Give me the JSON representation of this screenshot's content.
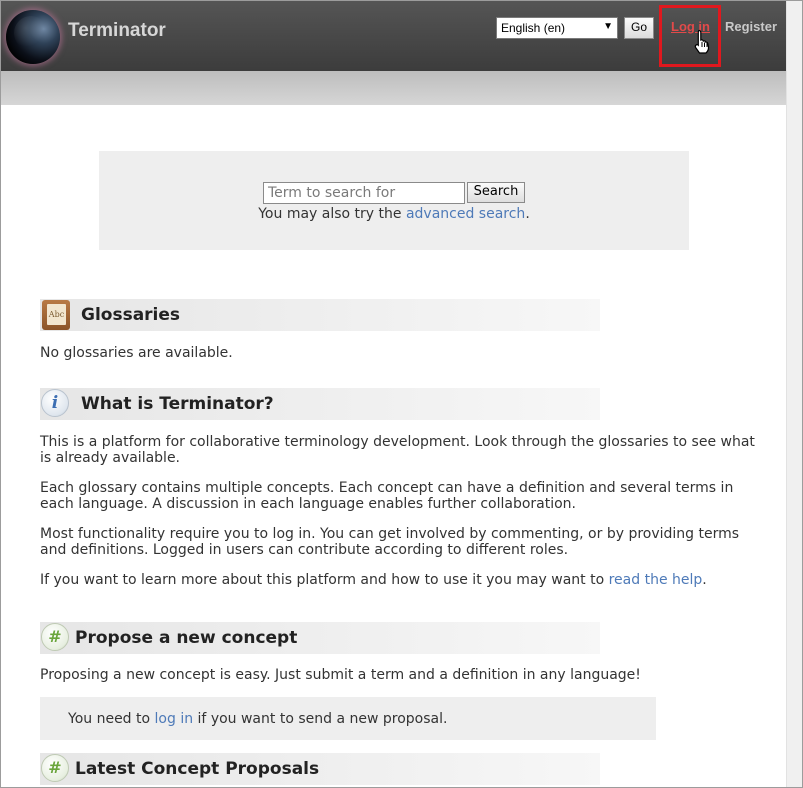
{
  "header": {
    "app_title": "Terminator",
    "language": {
      "selected": "English (en)"
    },
    "go_label": "Go",
    "login_label": "Log in",
    "register_label": "Register"
  },
  "search": {
    "placeholder": "Term to search for",
    "button_label": "Search",
    "hint_prefix": "You may also try the ",
    "hint_link": "advanced search",
    "hint_suffix": "."
  },
  "sections": {
    "glossaries": {
      "title": "Glossaries",
      "icon_text": "Abc",
      "empty_text": "No glossaries are available."
    },
    "about": {
      "title": "What is Terminator?",
      "icon_glyph": "i",
      "p1": "This is a platform for collaborative terminology development. Look through the glossaries to see what is already available.",
      "p2": "Each glossary contains multiple concepts. Each concept can have a definition and several terms in each language. A discussion in each language enables further collaboration.",
      "p3": "Most functionality require you to log in. You can get involved by commenting, or by providing terms and definitions. Logged in users can contribute according to different roles.",
      "p4_prefix": "If you want to learn more about this platform and how to use it you may want to ",
      "p4_link": "read the help",
      "p4_suffix": "."
    },
    "propose": {
      "title": "Propose a new concept",
      "icon_glyph": "#",
      "text": "Proposing a new concept is easy. Just submit a term and a definition in any language!",
      "note_prefix": "You need to ",
      "note_link": "log in",
      "note_suffix": " if you want to send a new proposal."
    },
    "latest": {
      "title": "Latest Concept Proposals",
      "icon_glyph": "#"
    }
  },
  "colors": {
    "header_bg": "#484848",
    "login_highlight": "#e0181e",
    "link": "#4e7ab8"
  }
}
